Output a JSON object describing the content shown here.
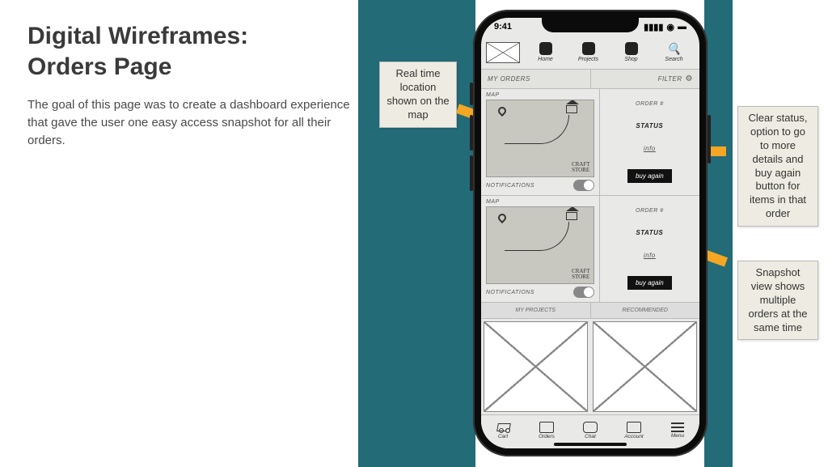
{
  "slide": {
    "title": "Digital Wireframes:\nOrders Page",
    "description": "The goal of this page was to create a dashboard experience that gave the user one easy access snapshot for all their orders."
  },
  "callouts": {
    "map": "Real time location shown on the map",
    "status": "Clear status, option to go to more details and buy again button for items in that order",
    "snapshot": "Snapshot view shows multiple orders at the same time"
  },
  "phone": {
    "time": "9:41",
    "nav_top": {
      "home": "Home",
      "projects": "Projects",
      "shop": "Shop",
      "search": "Search"
    },
    "section": {
      "my_orders": "MY ORDERS",
      "filter": "FILTER"
    },
    "order": {
      "map_label": "MAP",
      "notifications": "NOTIFICATIONS",
      "order_num": "ORDER #",
      "status": "STATUS",
      "info": "info",
      "buy_again": "buy again",
      "map_store_text": "CRAFT\nSTORE"
    },
    "proj_section": {
      "my_projects": "MY PROJECTS",
      "recommended": "RECOMMENDED"
    },
    "nav_bottom": {
      "cart": "Cart",
      "orders": "Orders",
      "chat": "Chat",
      "account": "Account",
      "menu": "Menu"
    }
  }
}
